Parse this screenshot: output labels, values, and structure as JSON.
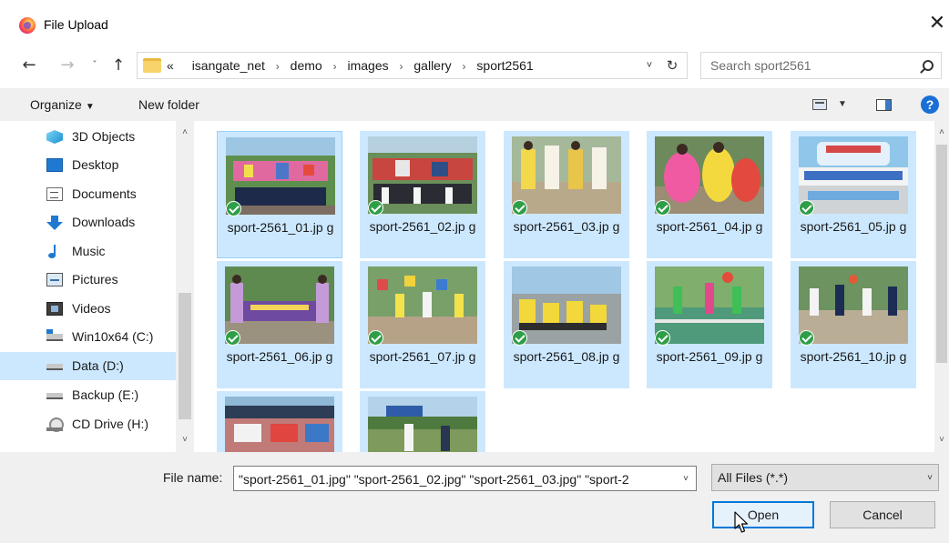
{
  "window": {
    "title": "File Upload",
    "close_glyph": "✕",
    "icon": "firefox-icon"
  },
  "nav": {
    "back_glyph": "←",
    "forward_glyph": "→",
    "recent_glyph": "˅",
    "up_glyph": "↑"
  },
  "address": {
    "prefix": "«",
    "crumbs": [
      "isangate_net",
      "demo",
      "images",
      "gallery",
      "sport2561"
    ],
    "separator": "›",
    "dropdown_glyph": "˅",
    "refresh_glyph": "↻"
  },
  "search": {
    "placeholder": "Search sport2561"
  },
  "toolbar": {
    "organize_label": "Organize",
    "organize_caret": "▼",
    "new_folder_label": "New folder",
    "view_caret": "▼",
    "help_glyph": "?"
  },
  "sidebar": {
    "items": [
      {
        "label": "3D Objects",
        "icon": "3d-objects-icon",
        "selected": false
      },
      {
        "label": "Desktop",
        "icon": "desktop-icon",
        "selected": false
      },
      {
        "label": "Documents",
        "icon": "documents-icon",
        "selected": false
      },
      {
        "label": "Downloads",
        "icon": "downloads-icon",
        "selected": false
      },
      {
        "label": "Music",
        "icon": "music-icon",
        "selected": false
      },
      {
        "label": "Pictures",
        "icon": "pictures-icon",
        "selected": false
      },
      {
        "label": "Videos",
        "icon": "videos-icon",
        "selected": false
      },
      {
        "label": "Win10x64 (C:)",
        "icon": "system-drive-icon",
        "selected": false
      },
      {
        "label": "Data (D:)",
        "icon": "drive-icon",
        "selected": true
      },
      {
        "label": "Backup (E:)",
        "icon": "drive-icon",
        "selected": false
      },
      {
        "label": "CD Drive (H:)",
        "icon": "cd-drive-icon",
        "selected": false
      }
    ],
    "scroll_up_glyph": "˄",
    "scroll_down_glyph": "˅"
  },
  "files": [
    {
      "name": "sport-2561_01.jpg",
      "label": "sport-2561_01.jp g",
      "selected": true,
      "checked": true
    },
    {
      "name": "sport-2561_02.jpg",
      "label": "sport-2561_02.jp g",
      "selected": true,
      "checked": true
    },
    {
      "name": "sport-2561_03.jpg",
      "label": "sport-2561_03.jp g",
      "selected": true,
      "checked": true
    },
    {
      "name": "sport-2561_04.jpg",
      "label": "sport-2561_04.jp g",
      "selected": true,
      "checked": true
    },
    {
      "name": "sport-2561_05.jpg",
      "label": "sport-2561_05.jp g",
      "selected": true,
      "checked": true
    },
    {
      "name": "sport-2561_06.jpg",
      "label": "sport-2561_06.jp g",
      "selected": true,
      "checked": true
    },
    {
      "name": "sport-2561_07.jpg",
      "label": "sport-2561_07.jp g",
      "selected": true,
      "checked": true
    },
    {
      "name": "sport-2561_08.jpg",
      "label": "sport-2561_08.jp g",
      "selected": true,
      "checked": true
    },
    {
      "name": "sport-2561_09.jpg",
      "label": "sport-2561_09.jp g",
      "selected": true,
      "checked": true
    },
    {
      "name": "sport-2561_10.jpg",
      "label": "sport-2561_10.jp g",
      "selected": true,
      "checked": true
    },
    {
      "name": "",
      "label": "",
      "selected": true,
      "checked": false
    },
    {
      "name": "",
      "label": "",
      "selected": true,
      "checked": false
    }
  ],
  "bottom": {
    "file_name_label": "File name:",
    "file_name_value": "\"sport-2561_01.jpg\" \"sport-2561_02.jpg\" \"sport-2561_03.jpg\" \"sport-2",
    "file_name_caret": "˅",
    "file_type_value": "All Files (*.*)",
    "file_type_caret": "˅",
    "open_label": "Open",
    "cancel_label": "Cancel"
  },
  "colors": {
    "selection": "#cce8ff",
    "selection_border": "#99d1ff",
    "accent": "#0078d7",
    "check": "#2e9e48"
  }
}
